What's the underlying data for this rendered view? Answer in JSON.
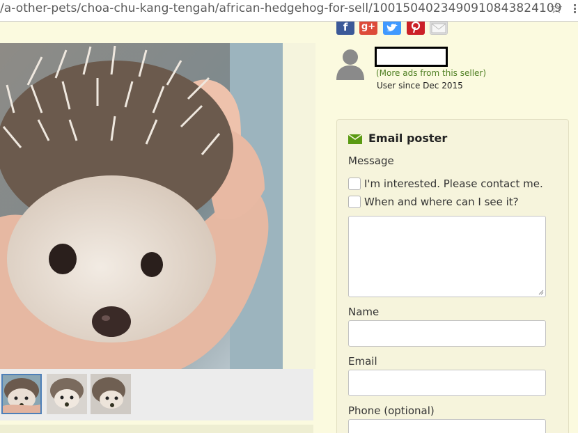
{
  "browser": {
    "url": "/a-other-pets/choa-chu-kang-tengah/african-hedgehog-for-sell/1001504023490910843824109"
  },
  "gallery": {
    "main_photo_alt": "African hedgehog held in a hand",
    "thumbnails": [
      "hedgehog photo 1",
      "hedgehog photo 2",
      "hedgehog photo 3"
    ]
  },
  "share": {
    "facebook": "f",
    "google": "g+",
    "twitter": "t",
    "pinterest": "p",
    "email": "email"
  },
  "seller": {
    "more_ads": "(More ads from this seller)",
    "user_since": "User since Dec 2015"
  },
  "email_form": {
    "title": "Email poster",
    "message_label": "Message",
    "options": [
      "I'm interested. Please contact me.",
      "When and where can I see it?"
    ],
    "name_label": "Name",
    "email_label": "Email",
    "phone_label": "Phone (optional)"
  },
  "colors": {
    "page_bg": "#fbfadf",
    "accent_green": "#4f7f23",
    "icon_green": "#5a9a12"
  }
}
